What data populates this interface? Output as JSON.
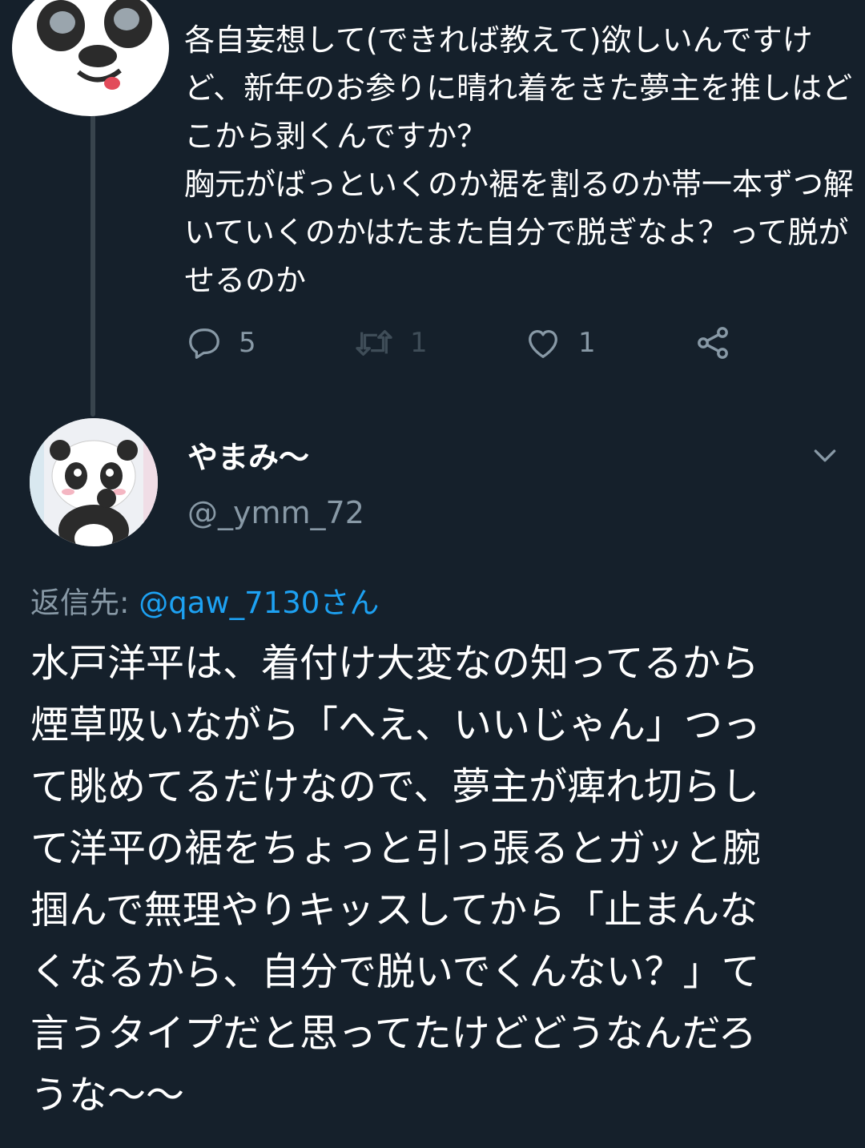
{
  "tweet1": {
    "lines": [
      "各自妄想して(できれば教えて)欲しいんですけ",
      "ど、新年のお参りに晴れ着をきた夢主を推しはど",
      "こから剥くんですか？",
      "胸元がばっといくのか裾を割るのか帯一本ずつ解",
      "いていくのかはたまた自分で脱ぎなよ？って脱が",
      "せるのか"
    ],
    "reply_count": "5",
    "retweet_count": "1",
    "like_count": "1"
  },
  "tweet2": {
    "display_name": "やまみ〜",
    "handle": "@_ymm_72",
    "reply_label": "返信先: ",
    "reply_mention": "@qaw_7130さん",
    "lines": [
      "水戸洋平は、着付け大変なの知ってるから",
      "煙草吸いながら「へえ、いいじゃん」つっ",
      "て眺めてるだけなので、夢主が痺れ切らし",
      "て洋平の裾をちょっと引っ張るとガッと腕",
      "掴んで無理やりキッスしてから「止まんな",
      "くなるから、自分で脱いでくんない？」て",
      "言うタイプだと思ってたけどどうなんだろ",
      "うな〜〜"
    ]
  },
  "icons": {
    "reply": "reply-icon",
    "retweet": "retweet-icon",
    "like": "heart-icon",
    "share": "share-icon",
    "more": "chevron-down-icon"
  },
  "colors": {
    "background": "#15202b",
    "secondary_text": "#8899a6",
    "link": "#1da1f2",
    "thread_line": "#38444d"
  }
}
